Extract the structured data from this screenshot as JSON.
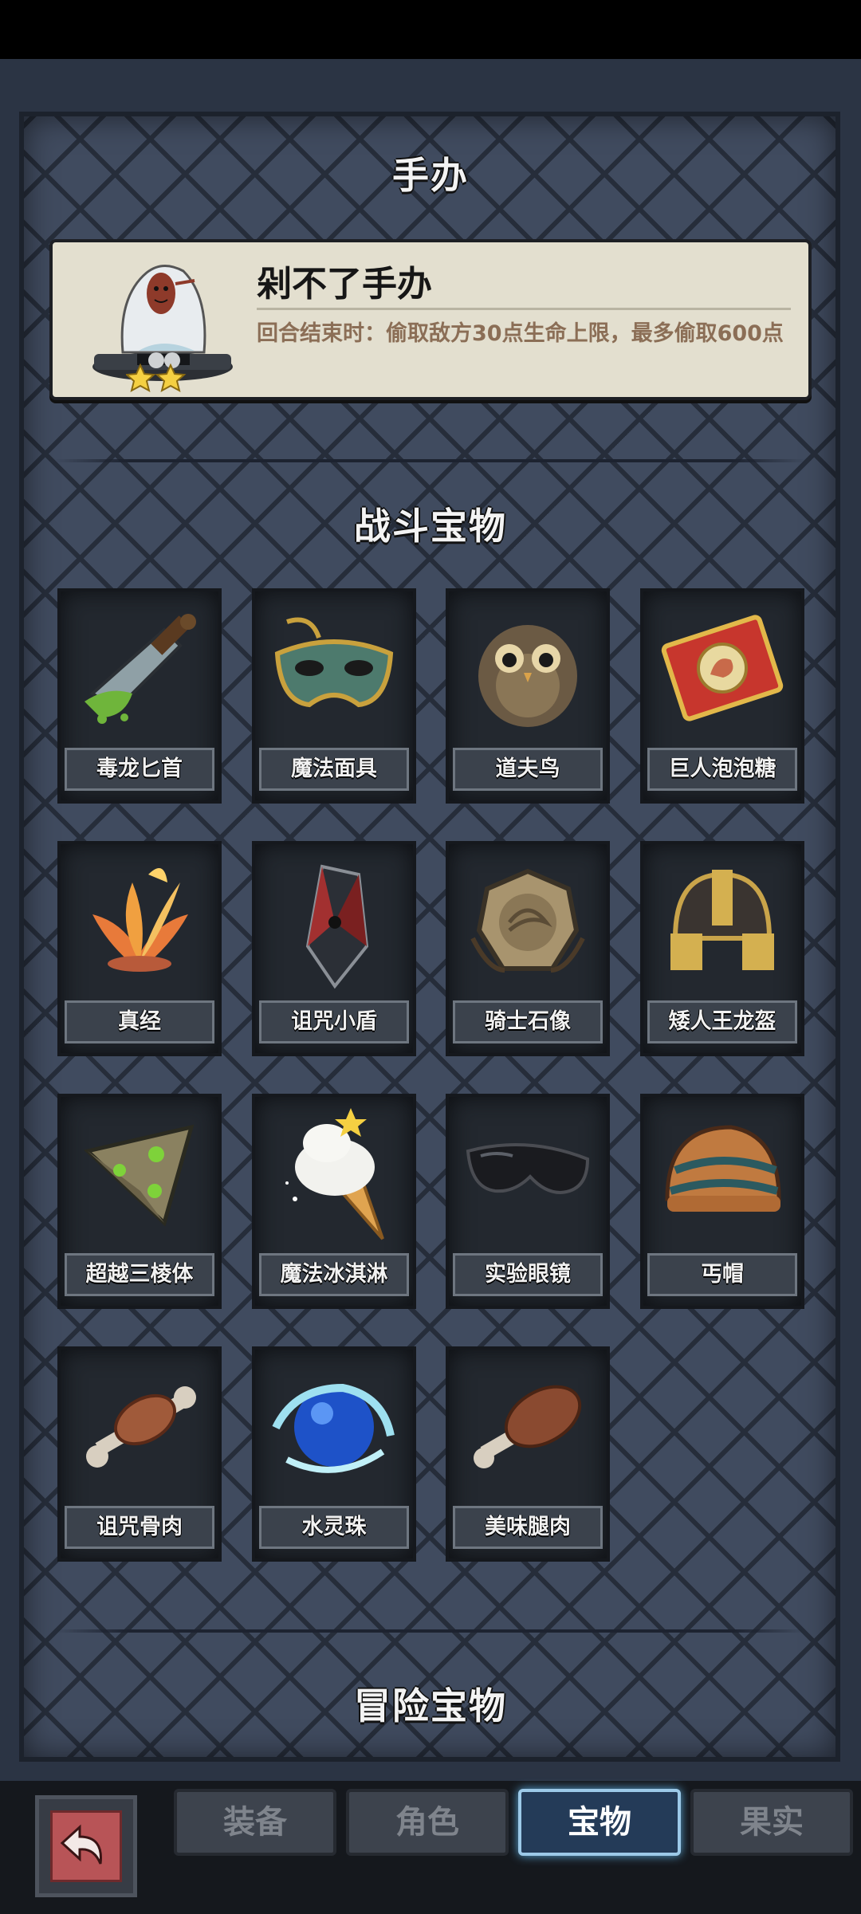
{
  "figure_section": {
    "title": "手办",
    "item": {
      "name": "剁不了手办",
      "description": "回合结束时：偷取敌方30点生命上限，最多偷取600点",
      "stars": 2
    }
  },
  "battle_section": {
    "title": "战斗宝物",
    "items": [
      {
        "label": "毒龙匕首",
        "icon": "poison-dagger-icon"
      },
      {
        "label": "魔法面具",
        "icon": "magic-mask-icon"
      },
      {
        "label": "道夫鸟",
        "icon": "owl-icon"
      },
      {
        "label": "巨人泡泡糖",
        "icon": "bubblegum-pack-icon"
      },
      {
        "label": "真经",
        "icon": "lotus-icon"
      },
      {
        "label": "诅咒小盾",
        "icon": "cursed-shield-icon"
      },
      {
        "label": "骑士石像",
        "icon": "knight-stone-icon"
      },
      {
        "label": "矮人王龙盔",
        "icon": "dwarf-helmet-icon"
      },
      {
        "label": "超越三棱体",
        "icon": "prism-icon"
      },
      {
        "label": "魔法冰淇淋",
        "icon": "ice-cream-icon"
      },
      {
        "label": "实验眼镜",
        "icon": "goggles-icon"
      },
      {
        "label": "丐帽",
        "icon": "beanie-icon"
      },
      {
        "label": "诅咒骨肉",
        "icon": "cursed-bone-meat-icon"
      },
      {
        "label": "水灵珠",
        "icon": "water-orb-icon"
      },
      {
        "label": "美味腿肉",
        "icon": "drumstick-icon"
      }
    ]
  },
  "adventure_section": {
    "title": "冒险宝物"
  },
  "tabs": [
    {
      "label": "装备",
      "active": false
    },
    {
      "label": "角色",
      "active": false
    },
    {
      "label": "宝物",
      "active": true
    },
    {
      "label": "果实",
      "active": false
    }
  ],
  "colors": {
    "panel": "#404b5f",
    "slot": "#23282f",
    "active_tab": "#243b58",
    "description": "#8b6e56"
  }
}
